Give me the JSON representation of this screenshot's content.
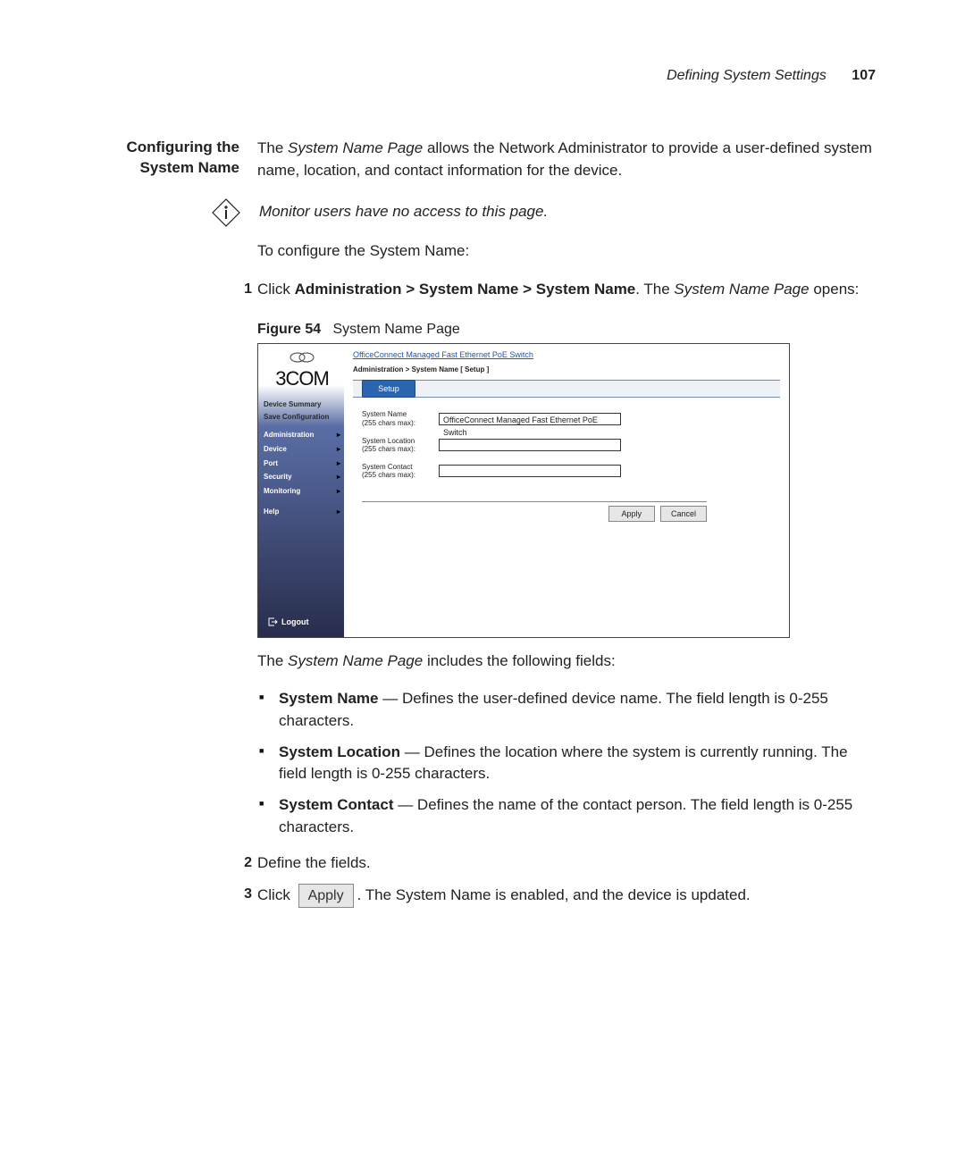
{
  "header": {
    "section": "Defining System Settings",
    "page": "107"
  },
  "section_title_l1": "Configuring the",
  "section_title_l2": "System Name",
  "intro_a": "The ",
  "intro_b_italic": "System Name Page",
  "intro_c": " allows the Network Administrator to provide a user-defined system name, location, and contact information for the device.",
  "note": "Monitor users have no access to this page.",
  "configure_line": "To configure the System Name:",
  "step1_a": "Click ",
  "step1_b_bold": "Administration > System Name > System Name",
  "step1_c": ". The ",
  "step1_d_italic": "System Name Page",
  "step1_e": " opens:",
  "figure": {
    "label_num": "Figure 54",
    "label_caption": "System Name Page",
    "brand": "3COM",
    "title": "OfficeConnect Managed Fast Ethernet PoE Switch",
    "breadcrumb": "Administration > System Name [ Setup ]",
    "tab": "Setup",
    "nav_top_1": "Device Summary",
    "nav_top_2": "Save Configuration",
    "nav_items": {
      "0": "Administration",
      "1": "Device",
      "2": "Port",
      "3": "Security",
      "4": "Monitoring",
      "5": "Help"
    },
    "form": {
      "name_label": "System Name",
      "name_hint": "(255 chars max):",
      "name_value": "OfficeConnect Managed Fast Ethernet PoE Switch",
      "location_label": "System Location",
      "location_hint": "(255 chars max):",
      "location_value": "",
      "contact_label": "System Contact",
      "contact_hint": "(255 chars max):",
      "contact_value": ""
    },
    "apply": "Apply",
    "cancel": "Cancel",
    "logout": "Logout"
  },
  "after_fig_a": "The ",
  "after_fig_b_italic": "System Name Page",
  "after_fig_c": " includes the following fields:",
  "fields": {
    "name_b": "System Name",
    "name_txt": " — Defines the user-defined device name. The field length is 0-255 characters.",
    "loc_b": "System Location",
    "loc_txt": " — Defines the location where the system is currently running. The field length is 0-255 characters.",
    "con_b": "System Contact",
    "con_txt": " — Defines the name of the contact person. The field length is 0-255 characters."
  },
  "step2": "Define the fields.",
  "step3_a": "Click ",
  "step3_btn": "Apply",
  "step3_b": ". The System Name is enabled, and the device is updated."
}
